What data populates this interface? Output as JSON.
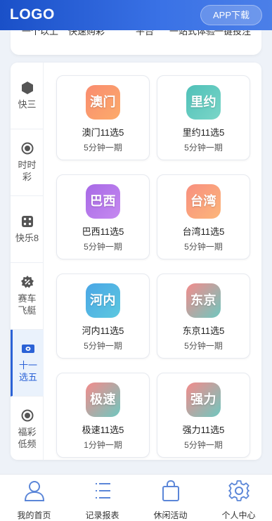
{
  "header": {
    "logo": "LOGO",
    "app_download": "APP下载"
  },
  "top_strip": {
    "cut_text": [
      "一个以上",
      "快速购彩",
      "平台",
      "一站式体验",
      "一键投注"
    ]
  },
  "sidebar": {
    "items": [
      {
        "label": "快三",
        "icon": "hexagon-icon",
        "active": false
      },
      {
        "label": "时时彩",
        "icon": "radio-target-icon",
        "active": false
      },
      {
        "label": "快乐8",
        "icon": "dice-icon",
        "active": false
      },
      {
        "label": "赛车飞艇",
        "icon": "gear-badge-icon",
        "active": false
      },
      {
        "label": "十一选五",
        "icon": "ticket-icon",
        "active": true
      },
      {
        "label": "福彩低频",
        "icon": "radio-target-icon",
        "active": false
      }
    ]
  },
  "games": [
    {
      "badge": "澳门",
      "name": "澳门11选5",
      "period": "5分钟一期",
      "color": "#f98c70"
    },
    {
      "badge": "里约",
      "name": "里约11选5",
      "period": "5分钟一期",
      "color": "#4fc0b8"
    },
    {
      "badge": "巴西",
      "name": "巴西11选5",
      "period": "5分钟一期",
      "color": "#a769e6"
    },
    {
      "badge": "台湾",
      "name": "台湾11选5",
      "period": "5分钟一期",
      "color": "#f88f7f"
    },
    {
      "badge": "河内",
      "name": "河内11选5",
      "period": "5分钟一期",
      "color": "#4aa6e6"
    },
    {
      "badge": "东京",
      "name": "东京11选5",
      "period": "5分钟一期",
      "color": "#f38b8b"
    },
    {
      "badge": "极速",
      "name": "极速11选5",
      "period": "1分钟一期",
      "color": "#f38b8b"
    },
    {
      "badge": "强力",
      "name": "强力11选5",
      "period": "5分钟一期",
      "color": "#f38b8b"
    }
  ],
  "tabbar": {
    "items": [
      {
        "label": "我的首页",
        "icon": "user-icon"
      },
      {
        "label": "记录报表",
        "icon": "list-icon"
      },
      {
        "label": "休闲活动",
        "icon": "shopping-bag-icon"
      },
      {
        "label": "个人中心",
        "icon": "gear-icon"
      }
    ]
  },
  "colors": {
    "header_start": "#1a50c8",
    "header_end": "#4b7fe8",
    "active_accent": "#2b62d6",
    "tab_icon": "#5b86d8"
  }
}
